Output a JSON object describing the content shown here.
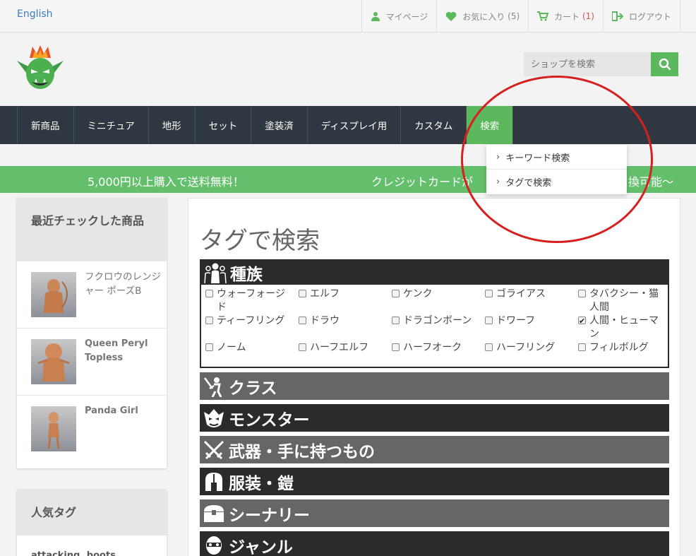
{
  "topbar": {
    "language": "English",
    "links": [
      {
        "label": "マイページ",
        "count": ""
      },
      {
        "label": "お気に入り",
        "count": "(5)"
      },
      {
        "label": "カート",
        "count": "(1)"
      },
      {
        "label": "ログアウト",
        "count": ""
      }
    ]
  },
  "search": {
    "placeholder": "ショップを検索"
  },
  "nav": {
    "items": [
      "新商品",
      "ミニチュア",
      "地形",
      "セット",
      "塗装済",
      "ディスプレイ用",
      "カスタム",
      "検索"
    ],
    "dropdown": [
      "キーワード検索",
      "タグで検索"
    ]
  },
  "promo": {
    "left": "5,000円以上購入で送料無料！",
    "middle": "クレジットカードが",
    "right": "換可能～"
  },
  "sidebar": {
    "recent_title": "最近チェックした商品",
    "products": [
      "フクロウのレンジャー ポーズB",
      "Queen Peryl Topless",
      "Panda Girl"
    ],
    "popular_title": "人気タグ",
    "popular_first": "attacking, boots"
  },
  "main": {
    "title": "タグで検索",
    "open_category": "種族",
    "race_tags": [
      {
        "label": "ウォーフォージド",
        "checked": false
      },
      {
        "label": "エルフ",
        "checked": false
      },
      {
        "label": "ケンク",
        "checked": false
      },
      {
        "label": "ゴライアス",
        "checked": false
      },
      {
        "label": "タバクシー・猫人間",
        "checked": false
      },
      {
        "label": "ティーフリング",
        "checked": false
      },
      {
        "label": "ドラウ",
        "checked": false
      },
      {
        "label": "ドラゴンボーン",
        "checked": false
      },
      {
        "label": "ドワーフ",
        "checked": false
      },
      {
        "label": "人間・ヒューマン",
        "checked": true
      },
      {
        "label": "ノーム",
        "checked": false
      },
      {
        "label": "ハーフエルフ",
        "checked": false
      },
      {
        "label": "ハーフオーク",
        "checked": false
      },
      {
        "label": "ハーフリング",
        "checked": false
      },
      {
        "label": "フィルボルグ",
        "checked": false
      }
    ],
    "categories": [
      "クラス",
      "モンスター",
      "武器・手に持つもの",
      "服装・鎧",
      "シーナリー",
      "ジャンル"
    ]
  },
  "colors": {
    "accent_green": "#5cb85c",
    "nav_dark": "#2f3840",
    "annotation_red": "#d62020"
  }
}
